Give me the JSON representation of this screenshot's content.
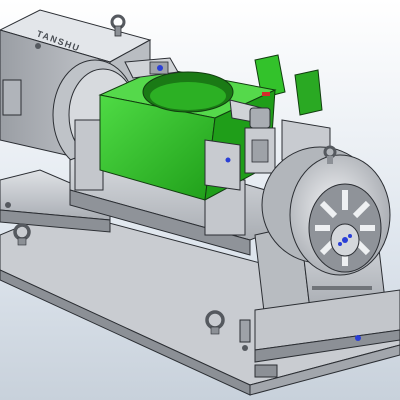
{
  "scene": {
    "subject": "cad-assembly-fixture",
    "engraved_text": "TANSHU",
    "colors": {
      "background_top": "#ffffff",
      "background_bottom": "#c8d1db",
      "metal_light": "#d5d8dc",
      "metal_mid": "#b6babf",
      "metal_dark": "#8c9096",
      "edge": "#2b2e33",
      "part_green": "#33c22b",
      "part_green_dark": "#1f8f19",
      "marker_blue": "#2a3fd6",
      "marker_red": "#d62a2a"
    }
  }
}
